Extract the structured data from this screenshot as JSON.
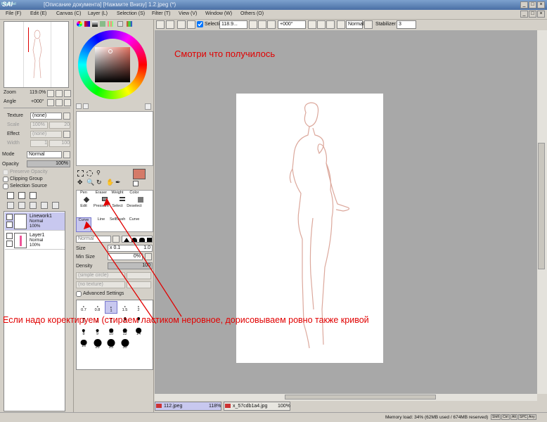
{
  "app": {
    "logo": "SAI",
    "brand": "PaintTool",
    "title": "[Описание документа] [Нажмите Внизу] 1.2.jpeg (*)"
  },
  "menu": [
    "File (F)",
    "Edit (E)",
    "Canvas (C)",
    "Layer (L)",
    "Selection (S)",
    "Filter (T)",
    "View (V)",
    "Window (W)",
    "Others (O)"
  ],
  "toolbar": {
    "selection_label": "Selection",
    "zoom": "118.9...",
    "rotation": "+000°",
    "blend": "Normal",
    "stabilizer_label": "Stabilizer",
    "stabilizer": "3"
  },
  "navigator": {
    "zoom_label": "Zoom",
    "zoom_value": "119.0%",
    "angle_label": "Angle",
    "angle_value": "+000°"
  },
  "texture": {
    "texture_label": "Texture",
    "texture_value": "(none)",
    "scale_label": "Scale",
    "scale_value": "100%",
    "scale_num": "20",
    "effect_label": "Effect",
    "effect_value": "(none)",
    "width_label": "Width",
    "width_num1": "1",
    "width_num2": "100"
  },
  "layer_props": {
    "mode_label": "Mode",
    "mode_value": "Normal",
    "opacity_label": "Opacity",
    "opacity_value": "100%",
    "preserve": "Preserve Opacity",
    "clipping": "Clipping Group",
    "selsource": "Selection Source"
  },
  "layers": [
    {
      "name": "Linework1",
      "mode": "Normal",
      "opacity": "100%"
    },
    {
      "name": "Layer1",
      "mode": "Normal",
      "opacity": "100%"
    }
  ],
  "tools": {
    "row1": [
      "Pen",
      "Eraser",
      "Weight",
      "Color"
    ],
    "row2": [
      "Edit",
      "Pressure",
      "Select",
      "Deselect"
    ],
    "row3": [
      "Curve",
      "Line",
      "SelBrush",
      "Curve"
    ]
  },
  "brush": {
    "blend": "Normal",
    "size_label": "Size",
    "size_mult": "x 0.1",
    "size_value": "1.0",
    "minsize_label": "Min Size",
    "minsize_value": "0%",
    "density_label": "Density",
    "density_value": "100",
    "shape": "(simple circle)",
    "texture": "(no texture)",
    "advanced": "Advanced Settings"
  },
  "brush_sizes": [
    "0.7",
    "0.8",
    "1",
    "1.5",
    "2",
    "3",
    "4",
    "5",
    "6",
    "7",
    "8",
    "9",
    "10",
    "12",
    "14",
    "16",
    "20",
    "25",
    "30"
  ],
  "annotations": {
    "top": "Смотри что получилось",
    "bottom": "Если надо коректируем (стираем ластиком неровное, дорисовываем ровно также кривой"
  },
  "tabs": [
    {
      "name": "112.jpeg",
      "zoom": "118%"
    },
    {
      "name": "x_57cdb1a4.jpg",
      "zoom": "100%"
    }
  ],
  "status": {
    "memory": "Memory load: 34% (62MB used / 674MB reserved)",
    "keys": [
      "Shift",
      "Ctrl",
      "Alt",
      "SPC",
      "Any"
    ]
  },
  "colors": {
    "primary": "#d47a68",
    "accent": "#c8c8ef",
    "annotation": "#e10000"
  }
}
